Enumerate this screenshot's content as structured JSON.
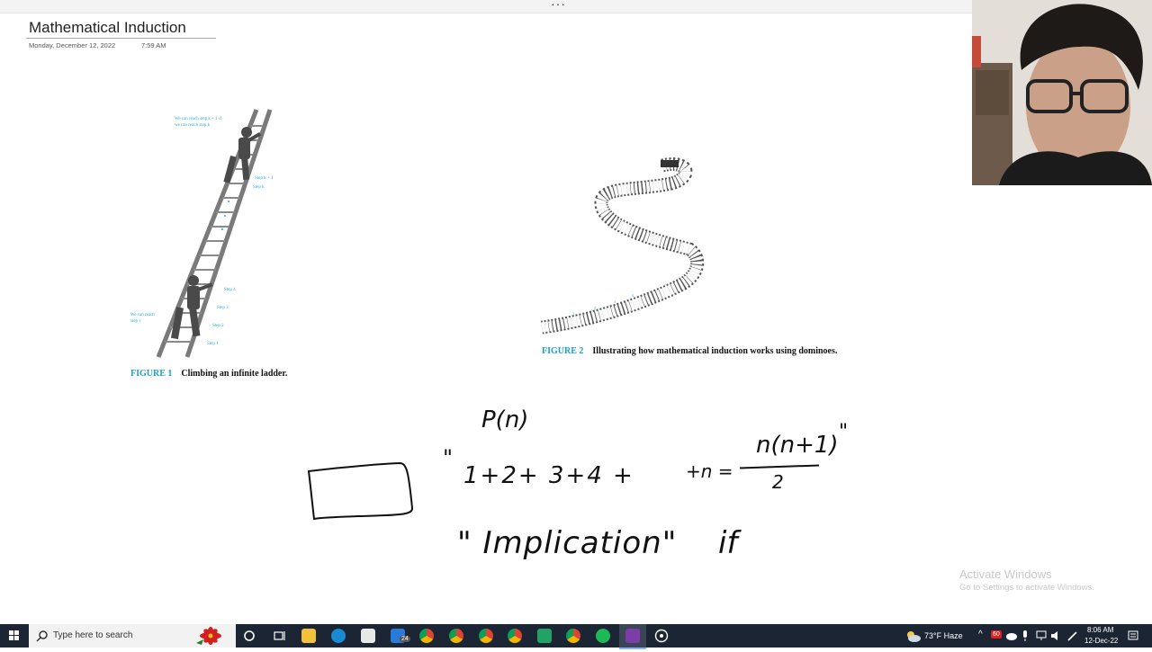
{
  "window": {
    "more_glyph": "···"
  },
  "page": {
    "title": "Mathematical Induction",
    "date": "Monday, December 12, 2022",
    "time": "7:59 AM"
  },
  "figure1": {
    "number": "FIGURE 1",
    "caption": "Climbing an infinite ladder.",
    "labels": {
      "top": "We can reach step k + 1 if",
      "top2": "we can reach step k",
      "step_k1": "Step k + 1",
      "step_k": "Step k",
      "step4": "Step 4",
      "step3": "Step 3",
      "step2": "Step 2",
      "step1": "Step 1",
      "reach1": "We can reach",
      "reach2": "step 1"
    }
  },
  "figure2": {
    "number": "FIGURE 2",
    "caption": "Illustrating how mathematical induction works using dominoes."
  },
  "handwriting": {
    "pn": "P(n)",
    "quote_open": "\"",
    "sum": "1+2+ 3+4 +",
    "plus_n": "+n =",
    "numerator": "n(n+1)",
    "denominator": "2",
    "quote_close": "\"",
    "implication": "\" Implication\"",
    "if": "if"
  },
  "watermark": {
    "line1": "Activate Windows",
    "line2": "Go to Settings to activate Windows."
  },
  "taskbar": {
    "search_placeholder": "Type here to search",
    "badge": "24",
    "weather": "73°F  Haze",
    "badge_red": "60",
    "clock_time": "8:06 AM",
    "clock_date": "12-Dec-22"
  }
}
